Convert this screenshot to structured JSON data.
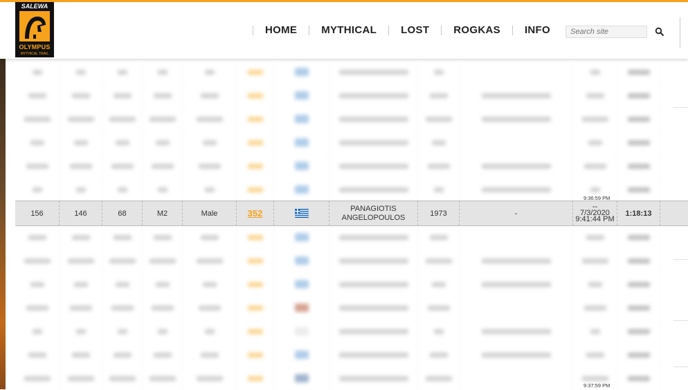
{
  "header": {
    "logo_brand": "SALEWA",
    "logo_name": "OLYMPUS",
    "logo_sub": "MYTHICAL TRAIL",
    "nav": [
      "HOME",
      "MYTHICAL",
      "LOST",
      "ROGKAS",
      "INFO"
    ],
    "search_placeholder": "Search site"
  },
  "results": {
    "highlighted_row": {
      "rank": "156",
      "gender_rank": "146",
      "category_rank": "68",
      "category": "M2",
      "gender": "Male",
      "bib": "352",
      "country_flag": "greece-flag",
      "name_line1": "PANAGIOTIS",
      "name_line2": "ANGELOPOULOS",
      "birth_year": "1973",
      "club": "-",
      "start_dash": "--",
      "date": "7/3/2020",
      "finish_clock": "9:41:44 PM",
      "time": "1:18:13"
    },
    "peek_above": "9:36:59 PM",
    "peek_bottom": "9:37:59 PM"
  },
  "colors": {
    "accent": "#f7a21b",
    "highlight_bg": "#e4e4e4"
  }
}
